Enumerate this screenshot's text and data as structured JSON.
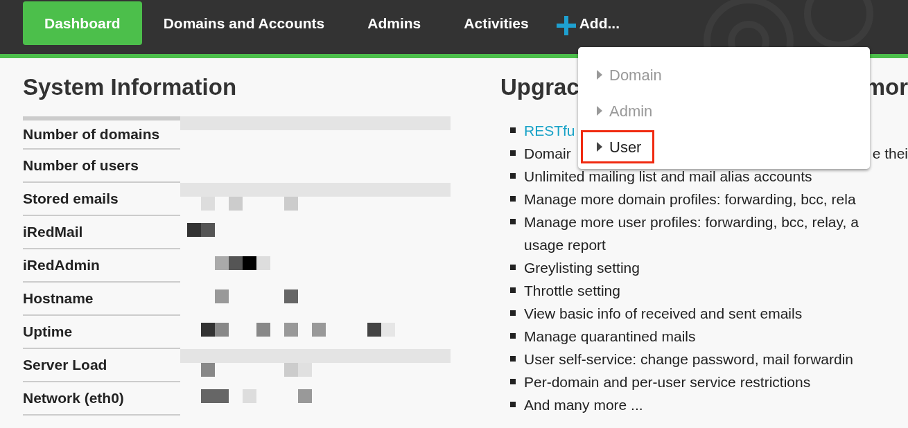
{
  "navbar": {
    "items": [
      {
        "label": "Dashboard",
        "selected": true,
        "kind": "link"
      },
      {
        "label": "Domains and Accounts",
        "selected": false,
        "kind": "link"
      },
      {
        "label": "Admins",
        "selected": false,
        "kind": "link"
      },
      {
        "label": "Activities",
        "selected": false,
        "kind": "link"
      },
      {
        "label": "Add...",
        "selected": false,
        "kind": "add"
      }
    ]
  },
  "add_menu": {
    "items": [
      {
        "label": "Domain",
        "highlighted": false
      },
      {
        "label": "Admin",
        "highlighted": false
      },
      {
        "label": "User",
        "highlighted": true
      }
    ]
  },
  "system_information": {
    "title": "System Information",
    "rows": [
      "Number of domains",
      "Number of users",
      "Stored emails",
      "iRedMail",
      "iRedAdmin",
      "Hostname",
      "Uptime",
      "Server Load",
      "Network (eth0)"
    ]
  },
  "upgrade": {
    "title_parts": [
      "Upgrac",
      "mor"
    ],
    "features": [
      {
        "kind": "link",
        "parts": [
          "RESTfu"
        ]
      },
      {
        "kind": "split",
        "parts": [
          "Domair",
          "e thei"
        ]
      },
      {
        "kind": "text",
        "parts": [
          "Unlimited mailing list and mail alias accounts"
        ]
      },
      {
        "kind": "text",
        "parts": [
          "Manage more domain profiles: forwarding, bcc, rela"
        ]
      },
      {
        "kind": "wrapped",
        "parts": [
          "Manage more user profiles: forwarding, bcc, relay, a",
          "usage report"
        ]
      },
      {
        "kind": "text",
        "parts": [
          "Greylisting setting"
        ]
      },
      {
        "kind": "text",
        "parts": [
          "Throttle setting"
        ]
      },
      {
        "kind": "text",
        "parts": [
          "View basic info of received and sent emails"
        ]
      },
      {
        "kind": "text",
        "parts": [
          "Manage quarantined mails"
        ]
      },
      {
        "kind": "text",
        "parts": [
          "User self-service: change password, mail forwardin"
        ]
      },
      {
        "kind": "text",
        "parts": [
          "Per-domain and per-user service restrictions"
        ]
      },
      {
        "kind": "text",
        "parts": [
          "And many more ..."
        ]
      }
    ]
  }
}
